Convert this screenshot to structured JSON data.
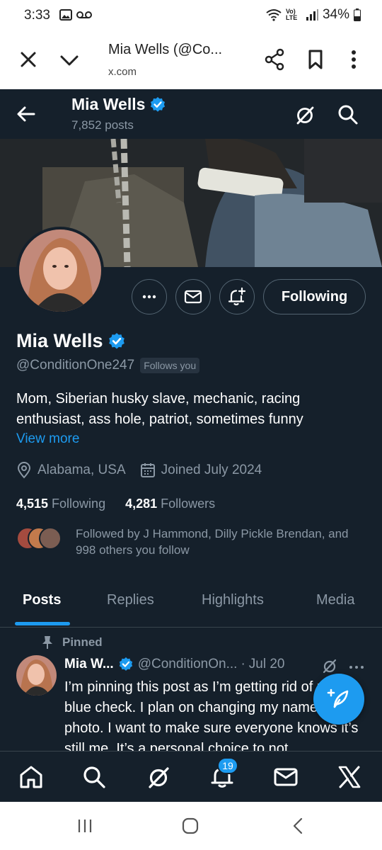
{
  "status_bar": {
    "time": "3:33",
    "network_label": "Vo) LTE",
    "battery": "34%"
  },
  "browser": {
    "title": "Mia Wells (@Co...",
    "url": "x.com"
  },
  "header": {
    "name": "Mia Wells",
    "posts": "7,852 posts"
  },
  "profile": {
    "following_button": "Following",
    "name": "Mia Wells",
    "handle": "@ConditionOne247",
    "follows_you": "Follows you",
    "bio": "Mom, Siberian husky slave, mechanic, racing enthusiast, ass hole, patriot, sometimes funny",
    "view_more": "View more",
    "location": "Alabama, USA",
    "joined": "Joined July 2024",
    "following_count": "4,515",
    "following_label": "Following",
    "followers_count": "4,281",
    "followers_label": "Followers",
    "followed_by": "Followed by J Hammond, Dilly Pickle Brendan, and 998 others you follow"
  },
  "tabs": [
    "Posts",
    "Replies",
    "Highlights",
    "Media"
  ],
  "tweet": {
    "pinned_label": "Pinned",
    "name": "Mia W...",
    "handle": "@ConditionOn...",
    "sep": "·",
    "date": "Jul 20",
    "text": "I’m pinning this post as I’m getting rid of my blue check. I plan on changing my name and photo. I want to make sure everyone knows it’s still me. It’s a personal choice to not"
  },
  "bottom_nav": {
    "notification_badge": "19"
  },
  "colors": {
    "background": "#15202b",
    "accent": "#1d9bf0",
    "muted_text": "#8b98a5",
    "border": "#536471"
  }
}
